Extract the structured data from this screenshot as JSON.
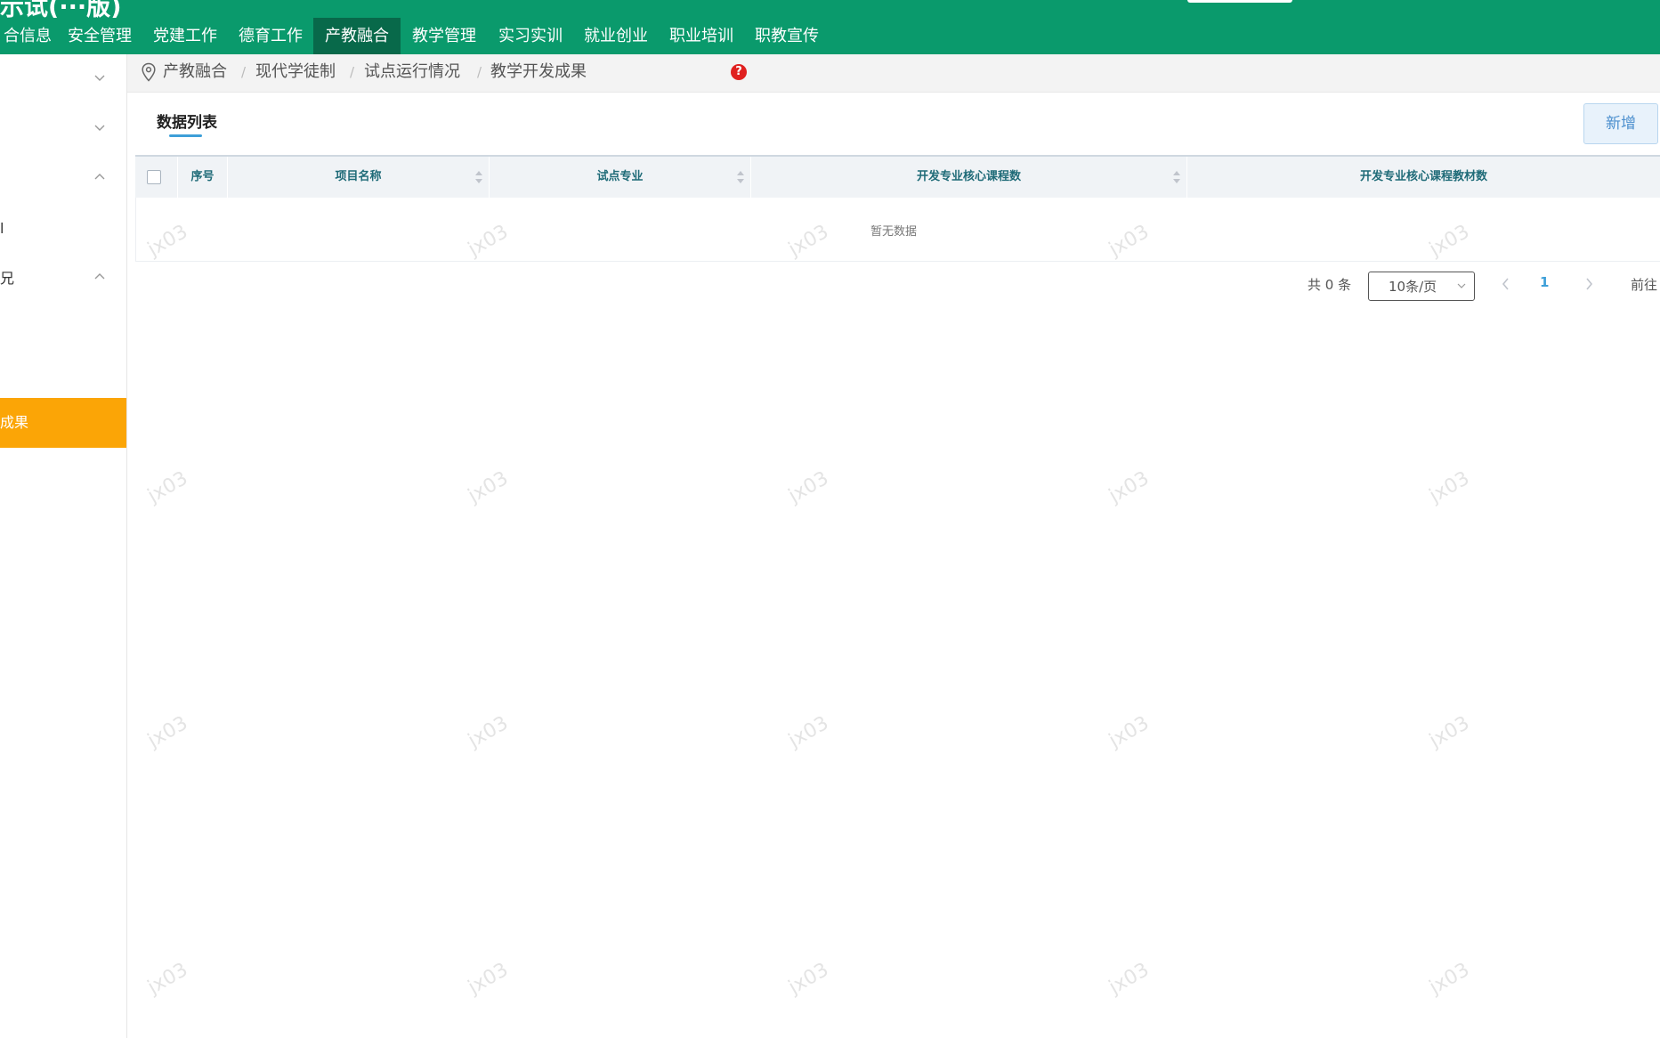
{
  "brand": {
    "title": "示试(···版)"
  },
  "nav": {
    "items": [
      {
        "label": "合信息"
      },
      {
        "label": "安全管理"
      },
      {
        "label": "党建工作"
      },
      {
        "label": "德育工作"
      },
      {
        "label": "产教融合"
      },
      {
        "label": "教学管理"
      },
      {
        "label": "实习实训"
      },
      {
        "label": "就业创业"
      },
      {
        "label": "职业培训"
      },
      {
        "label": "职教宣传"
      }
    ],
    "active_index": 4
  },
  "sidebar": {
    "items": [
      {
        "label": "",
        "chevron": "chevron-down-icon"
      },
      {
        "label": "",
        "chevron": "chevron-down-icon"
      },
      {
        "label": "",
        "chevron": "chevron-up-icon"
      },
      {
        "label": "l",
        "chevron": ""
      },
      {
        "label": "兄",
        "chevron": "chevron-up-icon"
      },
      {
        "label": "成果",
        "chevron": "",
        "active": true
      }
    ],
    "active_color": "#fba506"
  },
  "breadcrumb": {
    "items": [
      "产教融合",
      "现代学徒制",
      "试点运行情况",
      "教学开发成果"
    ],
    "separator": "/",
    "help": "?"
  },
  "panel": {
    "tab_title": "数据列表",
    "add_label": "新增"
  },
  "table": {
    "columns": [
      "序号",
      "项目名称",
      "试点专业",
      "开发专业核心课程数",
      "开发专业核心课程教材数"
    ],
    "empty_text": "暂无数据"
  },
  "pagination": {
    "total_label": "共 0 条",
    "page_size": "10条/页",
    "current_page": "1",
    "goto_label": "前往"
  },
  "watermark": {
    "text": "jx03"
  },
  "colors": {
    "primary": "#0a9a6c",
    "nav_active": "#08694a",
    "accent": "#3d9fd8",
    "header_text": "#1f6b78"
  }
}
